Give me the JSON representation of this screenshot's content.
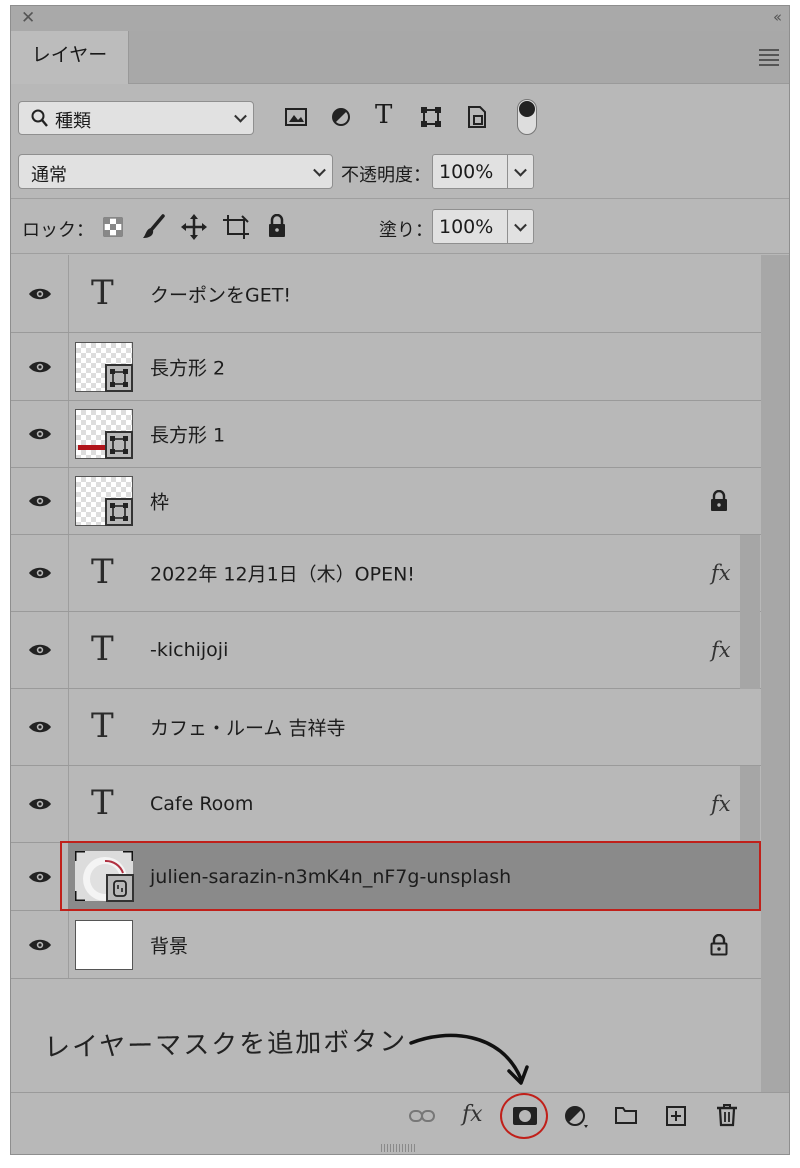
{
  "panel": {
    "tab_label": "レイヤー"
  },
  "filter": {
    "kind_label": "種類",
    "icons": [
      "image-filter-icon",
      "adjustment-filter-icon",
      "type-filter-icon",
      "shape-filter-icon",
      "smart-object-filter-icon",
      "filter-toggle-icon"
    ]
  },
  "blend": {
    "mode": "通常",
    "opacity_label": "不透明度：",
    "opacity_value": "100%"
  },
  "lock": {
    "label": "ロック：",
    "fill_label": "塗り：",
    "fill_value": "100%"
  },
  "layers": [
    {
      "name": "クーポンをGET!",
      "kind": "text",
      "fx": false,
      "locked": false,
      "selected": false
    },
    {
      "name": "長方形 2",
      "kind": "shape",
      "fx": false,
      "locked": false,
      "selected": false
    },
    {
      "name": "長方形 1",
      "kind": "shape",
      "fx": false,
      "locked": false,
      "selected": false
    },
    {
      "name": "枠",
      "kind": "shape",
      "fx": false,
      "locked": true,
      "selected": false
    },
    {
      "name": "2022年 12月1日（木）OPEN!",
      "kind": "text",
      "fx": true,
      "locked": false,
      "selected": false
    },
    {
      "name": "-kichijoji",
      "kind": "text",
      "fx": true,
      "locked": false,
      "selected": false
    },
    {
      "name": "カフェ・ルーム 吉祥寺",
      "kind": "text",
      "fx": false,
      "locked": false,
      "selected": false
    },
    {
      "name": "Cafe Room",
      "kind": "text",
      "fx": true,
      "locked": false,
      "selected": false
    },
    {
      "name": "julien-sarazin-n3mK4n_nF7g-unsplash",
      "kind": "smart-object",
      "fx": false,
      "locked": false,
      "selected": true
    },
    {
      "name": "背景",
      "kind": "background",
      "fx": false,
      "locked": true,
      "selected": false
    }
  ],
  "fx_label": "fx",
  "annotation": {
    "text": "レイヤーマスクを追加ボタン"
  },
  "footer_icons": [
    "link-layers-icon",
    "add-layer-style-icon",
    "add-layer-mask-icon",
    "adjustment-layer-icon",
    "new-group-icon",
    "new-layer-icon",
    "delete-layer-icon"
  ],
  "colors": {
    "panel_bg": "#b8b8b8",
    "selected_row": "#8a8a8a",
    "highlight_red": "#c0201a"
  }
}
